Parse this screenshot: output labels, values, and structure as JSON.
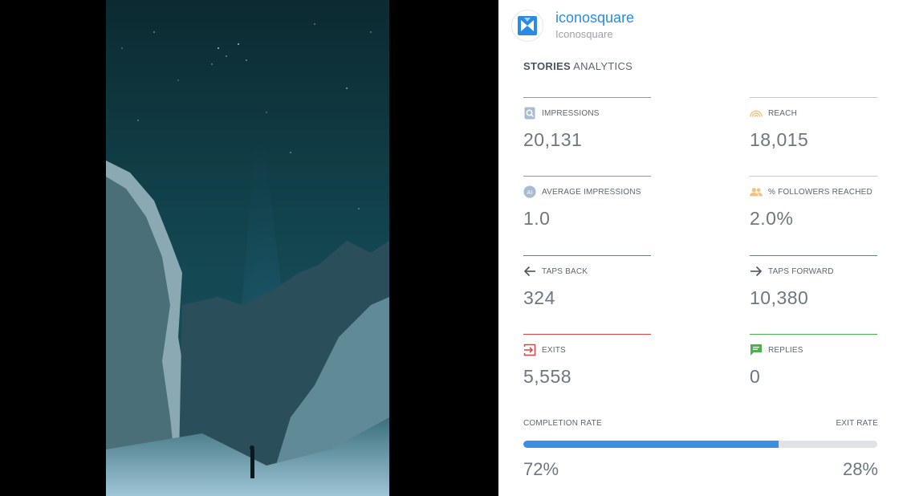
{
  "account": {
    "name": "iconosquare",
    "subtitle": "Iconosquare",
    "avatar_icon": "iconosquare-logo-icon"
  },
  "section": {
    "title_bold": "STORIES",
    "title_rest": " ANALYTICS"
  },
  "metrics": {
    "impressions": {
      "label": "IMPRESSIONS",
      "value": "20,131",
      "icon": "impressions-icon",
      "color": "#7a9cc0"
    },
    "reach": {
      "label": "REACH",
      "value": "18,015",
      "icon": "reach-icon",
      "color": "#f1c27c"
    },
    "avg_impressions": {
      "label": "AVERAGE IMPRESSIONS",
      "value": "1.0",
      "icon": "ai-icon",
      "icon_text": "AI",
      "color": "#7a9cc0"
    },
    "followers_reached": {
      "label": "% FOLLOWERS REACHED",
      "value": "2.0%",
      "icon": "followers-icon",
      "color": "#f1c27c"
    },
    "taps_back": {
      "label": "TAPS BACK",
      "value": "324",
      "icon": "arrow-left-icon",
      "color": "#6f7a85"
    },
    "taps_forward": {
      "label": "TAPS FORWARD",
      "value": "10,380",
      "icon": "arrow-right-icon",
      "color": "#6f7a85"
    },
    "exits": {
      "label": "EXITS",
      "value": "5,558",
      "icon": "exit-icon",
      "color": "#e0433f"
    },
    "replies": {
      "label": "REPLIES",
      "value": "0",
      "icon": "replies-icon",
      "color": "#4caf50"
    }
  },
  "rates": {
    "completion_label": "COMPLETION RATE",
    "exit_label": "EXIT RATE",
    "completion_value": "72%",
    "exit_value": "28%",
    "completion_fraction": 0.72,
    "bar_color": "#3b8fe2",
    "track_color": "#dfe2e6"
  },
  "colors": {
    "brand_blue": "#2a8be4"
  }
}
